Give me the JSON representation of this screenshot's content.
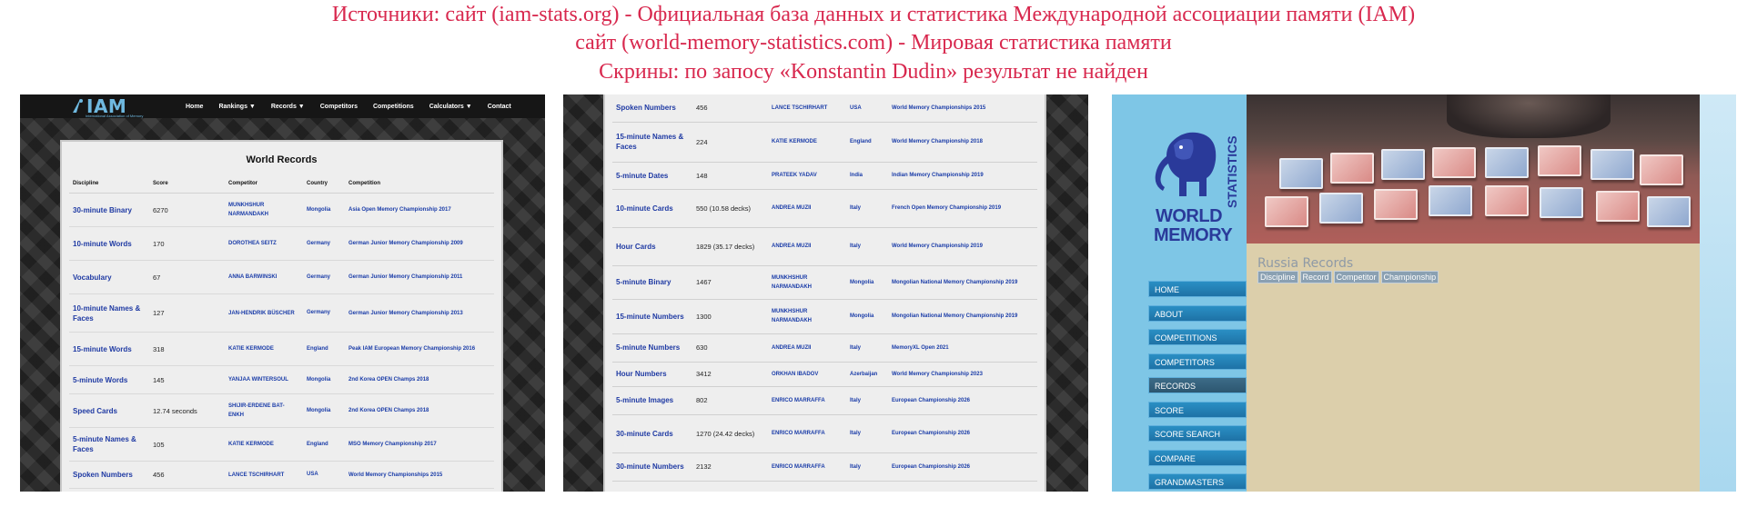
{
  "captions": [
    "Источники: сайт (iam-stats.org) - Официальная база данных и статистика Международной ассоциации памяти (IAM)",
    "сайт (world-memory-statistics.com) - Мировая статистика памяти",
    "Скрины: по запосу «Konstantin Dudin» результат не найден"
  ],
  "caption_color": "#d8284e",
  "iam": {
    "logo_text": "IAM",
    "logo_subtitle": "International Association of Memory",
    "nav": [
      "Home",
      "Rankings ▼",
      "Records ▼",
      "Competitors",
      "Competitions",
      "Calculators ▼",
      "Contact"
    ],
    "title": "World Records",
    "columns": [
      "Discipline",
      "Score",
      "Competitor",
      "Country",
      "Competition"
    ],
    "rows": [
      [
        "30-minute Binary",
        "6270",
        "MUNKHSHUR NARMANDAKH",
        "Mongolia",
        "Asia Open Memory Championship 2017"
      ],
      [
        "10-minute Words",
        "170",
        "DOROTHEA SEITZ",
        "Germany",
        "German Junior Memory Championship 2009"
      ],
      [
        "Vocabulary",
        "67",
        "ANNA BARWINSKI",
        "Germany",
        "German Junior Memory Championship 2011"
      ],
      [
        "10-minute Names & Faces",
        "127",
        "JAN-HENDRIK BÜSCHER",
        "Germany",
        "German Junior Memory Championship 2013"
      ],
      [
        "15-minute Words",
        "318",
        "KATIE KERMODE",
        "England",
        "Peak IAM European Memory Championship 2016"
      ],
      [
        "5-minute Words",
        "145",
        "YANJAA WINTERSOUL",
        "Mongolia",
        "2nd Korea OPEN Champs 2018"
      ],
      [
        "Speed Cards",
        "12.74 seconds",
        "SHIJIR-ERDENE BAT-ENKH",
        "Mongolia",
        "2nd Korea OPEN Champs 2018"
      ],
      [
        "5-minute Names & Faces",
        "105",
        "KATIE KERMODE",
        "England",
        "MSO Memory Championship 2017"
      ],
      [
        "Spoken Numbers",
        "456",
        "LANCE TSCHIRHART",
        "USA",
        "World Memory Championships 2015"
      ]
    ],
    "rows_continued": [
      [
        "Spoken Numbers",
        "456",
        "LANCE TSCHIRHART",
        "USA",
        "World Memory Championships 2015"
      ],
      [
        "15-minute Names & Faces",
        "224",
        "KATIE KERMODE",
        "England",
        "World Memory Championship 2018"
      ],
      [
        "5-minute Dates",
        "148",
        "PRATEEK YADAV",
        "India",
        "Indian Memory Championship 2019"
      ],
      [
        "10-minute Cards",
        "550 (10.58 decks)",
        "ANDREA MUZII",
        "Italy",
        "French Open Memory Championship 2019"
      ],
      [
        "Hour Cards",
        "1829 (35.17 decks)",
        "ANDREA MUZII",
        "Italy",
        "World Memory Championship 2019"
      ],
      [
        "5-minute Binary",
        "1467",
        "MUNKHSHUR NARMANDAKH",
        "Mongolia",
        "Mongolian National Memory Championship 2019"
      ],
      [
        "15-minute Numbers",
        "1300",
        "MUNKHSHUR NARMANDAKH",
        "Mongolia",
        "Mongolian National Memory Championship 2019"
      ],
      [
        "5-minute Numbers",
        "630",
        "ANDREA MUZII",
        "Italy",
        "MemoryXL Open 2021"
      ],
      [
        "Hour Numbers",
        "3412",
        "ORKHAN IBADOV",
        "Azerbaijan",
        "World Memory Championship 2023"
      ],
      [
        "5-minute Images",
        "802",
        "ENRICO MARRAFFA",
        "Italy",
        "European Championship 2026"
      ],
      [
        "30-minute Cards",
        "1270 (24.42 decks)",
        "ENRICO MARRAFFA",
        "Italy",
        "European Championship 2026"
      ],
      [
        "30-minute Numbers",
        "2132",
        "ENRICO MARRAFFA",
        "Italy",
        "European Championship 2026"
      ]
    ]
  },
  "wms": {
    "logo_line1": "WORLD",
    "logo_line2": "MEMORY",
    "logo_vertical": "STATISTICS",
    "menu": [
      "HOME",
      "ABOUT",
      "COMPETITIONS",
      "COMPETITORS",
      "RECORDS",
      "SCORE",
      "SCORE SEARCH",
      "COMPARE",
      "GRANDMASTERS"
    ],
    "active_menu": "RECORDS",
    "heading": "Russia Records",
    "tabs": [
      "Discipline",
      "Record",
      "Competitor",
      "Championship"
    ]
  }
}
